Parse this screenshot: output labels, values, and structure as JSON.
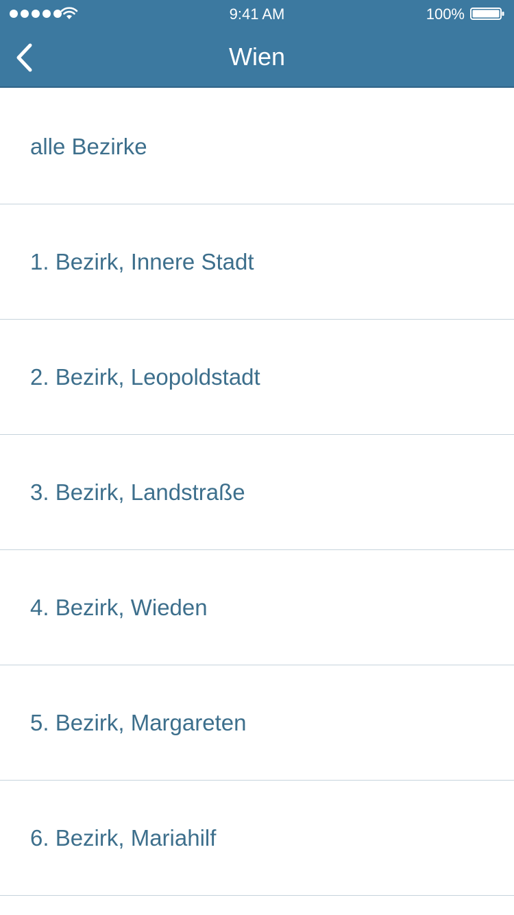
{
  "status_bar": {
    "time": "9:41 AM",
    "battery_percent": "100%",
    "signal_bars": 5,
    "icons": [
      "signal-dots-icon",
      "wifi-icon",
      "battery-icon"
    ]
  },
  "nav": {
    "title": "Wien",
    "back_icon": "chevron-left-icon"
  },
  "colors": {
    "header_bg": "#3c79a0",
    "item_text": "#3d6f8c",
    "divider": "#c6d3dc"
  },
  "list": {
    "items": [
      {
        "label": "alle Bezirke"
      },
      {
        "label": "1. Bezirk, Innere Stadt"
      },
      {
        "label": "2. Bezirk, Leopoldstadt"
      },
      {
        "label": "3. Bezirk, Landstraße"
      },
      {
        "label": "4. Bezirk, Wieden"
      },
      {
        "label": "5. Bezirk, Margareten"
      },
      {
        "label": "6. Bezirk, Mariahilf"
      }
    ]
  }
}
